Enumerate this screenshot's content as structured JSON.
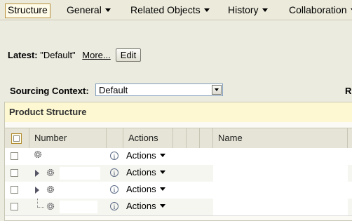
{
  "menubar": {
    "items": [
      {
        "label": "Structure",
        "active": true
      },
      {
        "label": "General",
        "has_caret": true
      },
      {
        "label": "Related Objects",
        "has_caret": true
      },
      {
        "label": "History",
        "has_caret": true
      },
      {
        "label": "Collaboration",
        "has_caret": true
      }
    ]
  },
  "latest": {
    "label": "Latest:",
    "value": "\"Default\"",
    "more_link": "More...",
    "edit_button": "Edit"
  },
  "sourcing": {
    "label": "Sourcing Context:",
    "selected": "Default",
    "right_cut_label": "R"
  },
  "panel": {
    "title": "Product Structure",
    "columns": {
      "number": "Number",
      "actions": "Actions",
      "name": "Name"
    },
    "rows": [
      {
        "actions_label": "Actions",
        "expandable": false
      },
      {
        "actions_label": "Actions",
        "expandable": true
      },
      {
        "actions_label": "Actions",
        "expandable": true
      },
      {
        "actions_label": "Actions",
        "expandable": false
      }
    ]
  },
  "icons": {
    "gear": "gear-icon",
    "info": "info-icon",
    "tree_expand": "tree-expand-icon",
    "dropdown": "dropdown-arrow-icon"
  }
}
